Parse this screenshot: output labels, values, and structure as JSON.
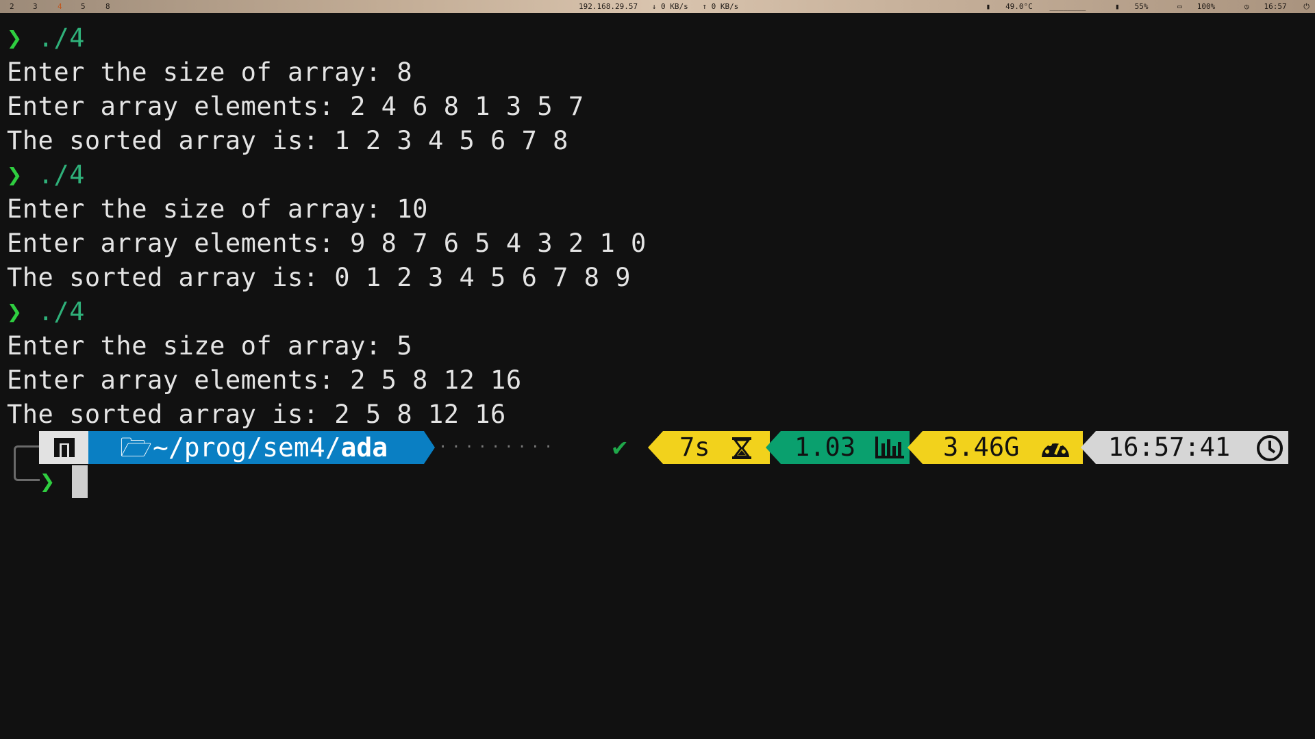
{
  "topbar": {
    "workspaces": [
      "2",
      "3",
      "4",
      "5",
      "8"
    ],
    "active_workspace": "4",
    "ip": "192.168.29.57",
    "down_speed": "↓ 0 KB/s",
    "up_speed": "↑ 0 KB/s",
    "temp": "49.0°C",
    "disk_usage_bar": "________",
    "brightness": "55%",
    "battery": "100%",
    "clock": "16:57"
  },
  "terminal": {
    "lines": [
      {
        "type": "prompt",
        "chevron": "❯",
        "command": "./4"
      },
      {
        "type": "output",
        "text": "Enter the size of array: 8"
      },
      {
        "type": "output",
        "text": "Enter array elements: 2 4 6 8 1 3 5 7"
      },
      {
        "type": "output",
        "text": "The sorted array is: 1 2 3 4 5 6 7 8"
      },
      {
        "type": "prompt",
        "chevron": "❯",
        "command": "./4"
      },
      {
        "type": "output",
        "text": "Enter the size of array: 10"
      },
      {
        "type": "output",
        "text": "Enter array elements: 9 8 7 6 5 4 3 2 1 0"
      },
      {
        "type": "output",
        "text": "The sorted array is: 0 1 2 3 4 5 6 7 8 9"
      },
      {
        "type": "prompt",
        "chevron": "❯",
        "command": "./4"
      },
      {
        "type": "output",
        "text": "Enter the size of array: 5"
      },
      {
        "type": "output",
        "text": "Enter array elements: 2 5 8 12 16"
      },
      {
        "type": "output",
        "text": "The sorted array is: 2 5 8 12 16"
      }
    ]
  },
  "powerline": {
    "os_icon": "manjaro-icon",
    "dir_prefix": "~/prog/sem4/",
    "dir_current": "ada",
    "dots": "·········",
    "status_ok": "✔",
    "duration": "7s",
    "load": "1.03",
    "memory": "3.46G",
    "time": "16:57:41",
    "prompt_chevron": "❯",
    "colors": {
      "dir": "#0a7fc3",
      "duration": "#f2d21c",
      "load": "#0aa06e",
      "memory": "#f2d21c",
      "time": "#d6d6d6",
      "ok": "#1fa84a"
    }
  }
}
